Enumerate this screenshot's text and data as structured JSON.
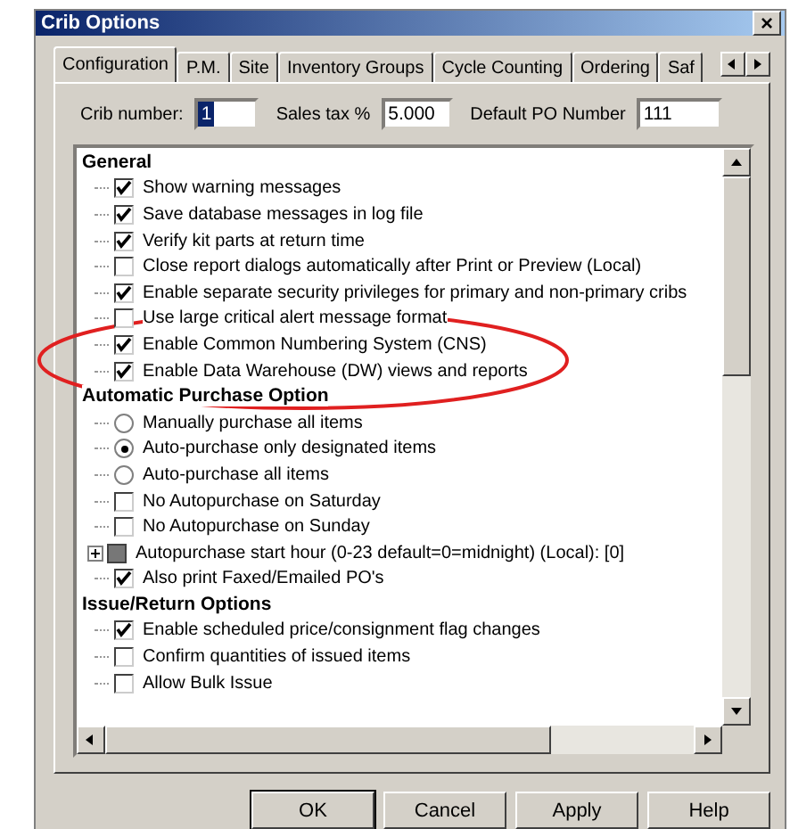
{
  "window": {
    "title": "Crib Options",
    "close": "×"
  },
  "tabs": [
    {
      "label": "Configuration",
      "selected": true
    },
    {
      "label": "P.M.",
      "selected": false
    },
    {
      "label": "Site",
      "selected": false
    },
    {
      "label": "Inventory Groups",
      "selected": false
    },
    {
      "label": "Cycle Counting",
      "selected": false
    },
    {
      "label": "Ordering",
      "selected": false
    },
    {
      "label": "Saf",
      "selected": false
    }
  ],
  "fields": [
    {
      "label": "Crib number:",
      "value": "1",
      "selected": true
    },
    {
      "label": "Sales tax %",
      "value": "5.000",
      "selected": false
    },
    {
      "label": "Default PO Number",
      "value": "111",
      "selected": false
    }
  ],
  "groups": [
    {
      "title": "General",
      "items": [
        {
          "kind": "checkbox",
          "label": "Show warning messages",
          "checked": true
        },
        {
          "kind": "checkbox",
          "label": "Save database messages in log file",
          "checked": true
        },
        {
          "kind": "checkbox",
          "label": "Verify kit parts at return time",
          "checked": true
        },
        {
          "kind": "checkbox",
          "label": "Close report dialogs automatically after Print or Preview (Local)",
          "checked": false
        },
        {
          "kind": "checkbox",
          "label": "Enable separate security privileges for primary and non-primary cribs",
          "checked": true
        },
        {
          "kind": "checkbox",
          "label": "Use large critical alert message format",
          "checked": false
        },
        {
          "kind": "checkbox",
          "label": "Enable Common Numbering System (CNS)",
          "checked": true,
          "highlighted": true
        },
        {
          "kind": "checkbox",
          "label": "Enable Data Warehouse (DW) views and reports",
          "checked": true,
          "highlighted": true
        }
      ]
    },
    {
      "title": "Automatic Purchase Option",
      "items": [
        {
          "kind": "radio",
          "label": "Manually purchase all items",
          "checked": false
        },
        {
          "kind": "radio",
          "label": "Auto-purchase only designated items",
          "checked": true
        },
        {
          "kind": "radio",
          "label": "Auto-purchase all items",
          "checked": false
        },
        {
          "kind": "checkbox",
          "label": "No Autopurchase on Saturday",
          "checked": false
        },
        {
          "kind": "checkbox",
          "label": "No Autopurchase on Sunday",
          "checked": false
        },
        {
          "kind": "value",
          "label": "Autopurchase start hour (0-23 default=0=midnight) (Local): [0]",
          "expanded": false
        },
        {
          "kind": "checkbox",
          "label": "Also print Faxed/Emailed PO's",
          "checked": true
        }
      ]
    },
    {
      "title": "Issue/Return Options",
      "items": [
        {
          "kind": "checkbox",
          "label": "Enable scheduled price/consignment flag changes",
          "checked": true
        },
        {
          "kind": "checkbox",
          "label": "Confirm quantities of issued items",
          "checked": false
        },
        {
          "kind": "checkbox",
          "label": "Allow Bulk Issue",
          "checked": false
        }
      ]
    }
  ],
  "buttons": [
    {
      "label": "OK",
      "default": true
    },
    {
      "label": "Cancel",
      "default": false
    },
    {
      "label": "Apply",
      "default": false
    },
    {
      "label": "Help",
      "default": false
    }
  ]
}
